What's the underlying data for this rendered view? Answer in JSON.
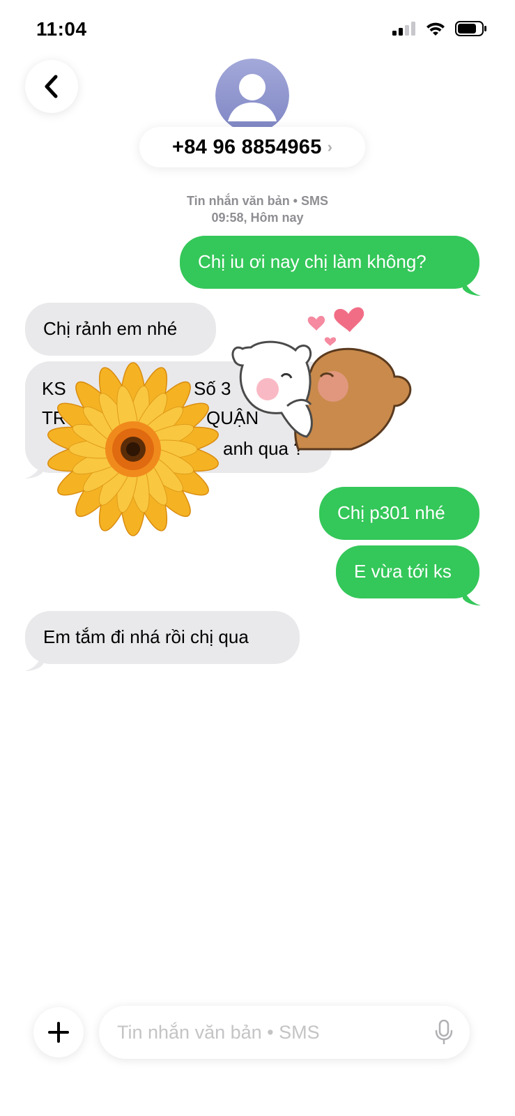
{
  "status_bar": {
    "time": "11:04"
  },
  "header": {
    "contact": "+84 96 8854965"
  },
  "thread": {
    "service_label": "Tin nhắn văn bản • SMS",
    "timestamp": "09:58, Hôm nay"
  },
  "messages": [
    {
      "direction": "outgoing",
      "text": "Chị iu ơi nay chị làm không?"
    },
    {
      "direction": "incoming",
      "text": "Chị rảnh em nhé"
    },
    {
      "direction": "incoming",
      "lines": [
        "KS",
        "Số 3",
        "TR",
        "QUẬN",
        "anh qua ?"
      ]
    },
    {
      "direction": "outgoing",
      "text": "Chị p301 nhé"
    },
    {
      "direction": "outgoing",
      "text": "E vừa tới ks"
    },
    {
      "direction": "incoming",
      "text": "Em tắm đi nhá rồi chị qua"
    }
  ],
  "stickers": [
    "flower-sticker",
    "bears-kissing-sticker"
  ],
  "compose": {
    "placeholder": "Tin nhắn văn bản • SMS"
  },
  "colors": {
    "outgoing_bubble": "#34c759",
    "incoming_bubble": "#e9e9eb",
    "meta_text": "#8e8e93"
  }
}
